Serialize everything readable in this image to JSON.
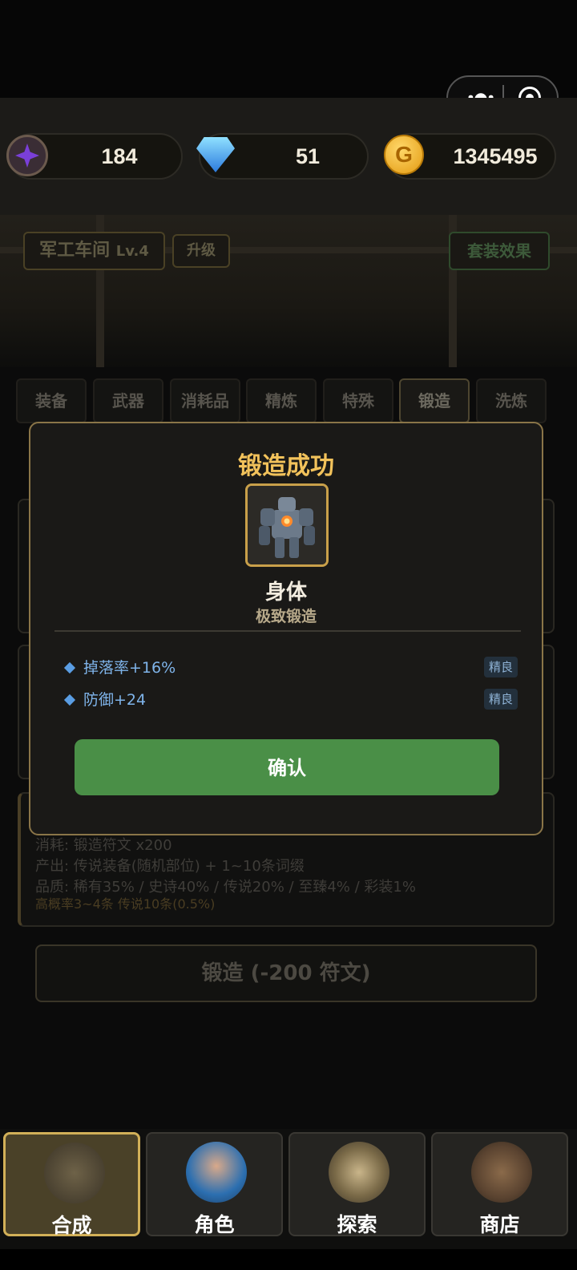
{
  "capsule": {
    "more_icon": "more-dots-icon",
    "close_icon": "target-icon"
  },
  "currency": {
    "crystal": "184",
    "diamond": "51",
    "gold": "1345495",
    "gold_symbol": "G"
  },
  "workshop": {
    "name": "军工车间",
    "level": "Lv.4",
    "upgrade_label": "升级",
    "set_effect_label": "套装效果"
  },
  "tabs": [
    "装备",
    "武器",
    "消耗品",
    "精炼",
    "特殊",
    "锻造",
    "洗炼"
  ],
  "active_tab": "锻造",
  "forge_info": {
    "line1": "消耗: 锻造符文 x200",
    "line2": "产出: 传说装备(随机部位) + 1~10条词缀",
    "line3": "品质: 稀有35% / 史诗40% / 传说20% / 至臻4% / 彩装1%",
    "line4": "高概率3~4条   传说10条(0.5%)",
    "button_label": "锻造 (-200 符文)"
  },
  "modal": {
    "title": "锻造成功",
    "item_name": "身体",
    "item_quality": "极致锻造",
    "attributes": [
      {
        "text": "掉落率+16%",
        "tag": "精良"
      },
      {
        "text": "防御+24",
        "tag": "精良"
      }
    ],
    "confirm_label": "确认"
  },
  "nav": [
    {
      "label": "合成",
      "icon": "crafting-icon"
    },
    {
      "label": "角色",
      "icon": "character-icon"
    },
    {
      "label": "探索",
      "icon": "compass-icon"
    },
    {
      "label": "商店",
      "icon": "shop-icon"
    }
  ],
  "colors": {
    "accent_gold": "#f2c25b",
    "confirm_green": "#4a8f47",
    "attr_blue": "#7fb4ea"
  }
}
